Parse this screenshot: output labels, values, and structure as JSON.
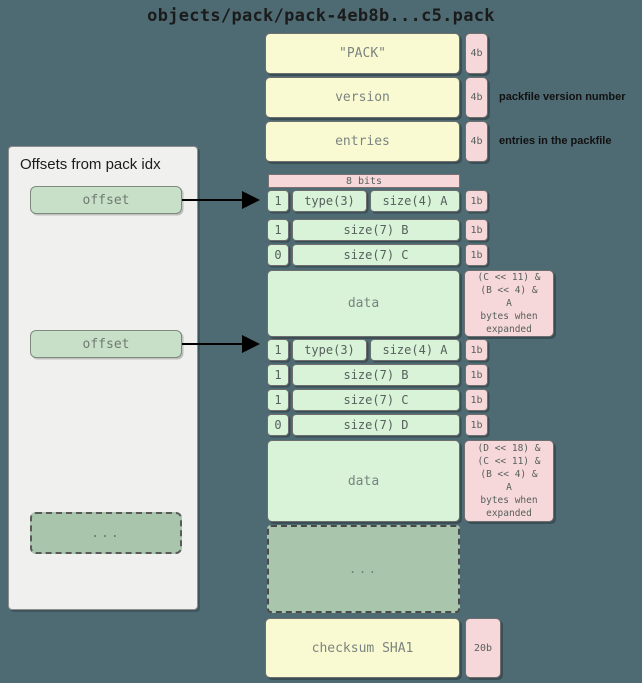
{
  "title": "objects/pack/pack-4eb8b...c5.pack",
  "colors": {
    "background": "#4e6a72",
    "header_block": "#fafad2",
    "entry_block": "#d8f3d8",
    "tag_block": "#f6d7da",
    "ellipsis_block": "#a9c6ad",
    "panel": "#f0f0ee"
  },
  "idx_panel": {
    "title": "Offsets from pack idx",
    "offsets": [
      {
        "label": "offset"
      },
      {
        "label": "offset"
      }
    ],
    "ellipsis": "..."
  },
  "header_blocks": [
    {
      "label": "\"PACK\"",
      "size": "4b",
      "note": ""
    },
    {
      "label": "version",
      "size": "4b",
      "note": "packfile version number"
    },
    {
      "label": "entries",
      "size": "4b",
      "note": "entries in the packfile"
    }
  ],
  "entries": [
    {
      "bits_label": "8 bits",
      "rows": [
        {
          "flag": "1",
          "segments": [
            "type(3)",
            "size(4) A"
          ],
          "size": "1b"
        },
        {
          "flag": "1",
          "segments": [
            "size(7) B"
          ],
          "size": "1b"
        },
        {
          "flag": "0",
          "segments": [
            "size(7) C"
          ],
          "size": "1b"
        }
      ],
      "data_label": "data",
      "expand_note": "(C << 11) &\n(B << 4) &\nA\nbytes when\nexpanded"
    },
    {
      "bits_label": "",
      "rows": [
        {
          "flag": "1",
          "segments": [
            "type(3)",
            "size(4) A"
          ],
          "size": "1b"
        },
        {
          "flag": "1",
          "segments": [
            "size(7) B"
          ],
          "size": "1b"
        },
        {
          "flag": "1",
          "segments": [
            "size(7) C"
          ],
          "size": "1b"
        },
        {
          "flag": "0",
          "segments": [
            "size(7) D"
          ],
          "size": "1b"
        }
      ],
      "data_label": "data",
      "expand_note": "(D << 18) &\n(C << 11) &\n(B << 4) &\nA\nbytes when\nexpanded"
    }
  ],
  "pack_ellipsis": "...",
  "checksum": {
    "label": "checksum SHA1",
    "size": "20b"
  }
}
